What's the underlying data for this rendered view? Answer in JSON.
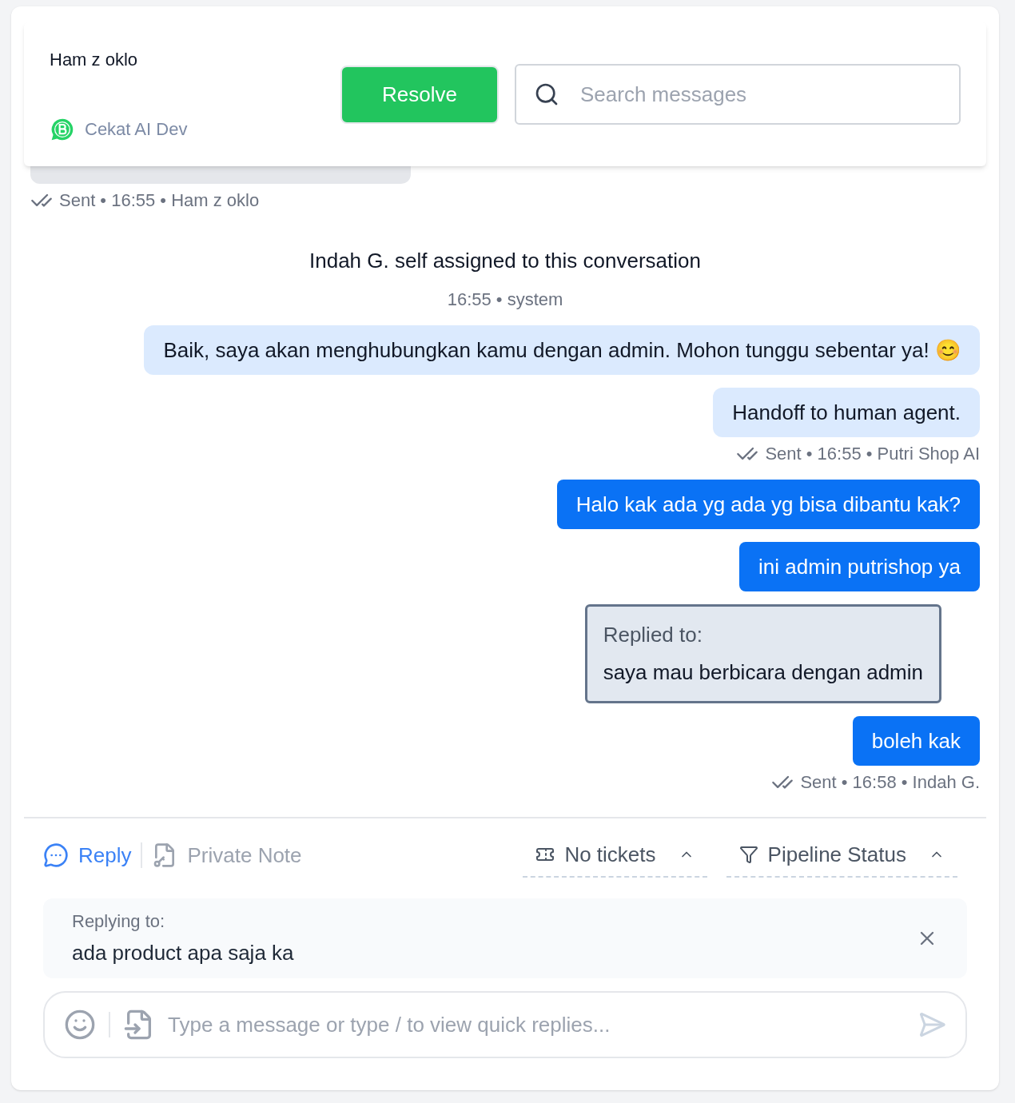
{
  "header": {
    "contact_name": "Ham z oklo",
    "inbox": "Cekat AI Dev",
    "resolve_button": "Resolve",
    "search": {
      "placeholder": "Search messages"
    }
  },
  "messages": [
    {
      "kind": "incoming-stub",
      "meta": "Sent • 16:55 • Ham z oklo"
    },
    {
      "kind": "system",
      "text": "Indah G. self assigned to this conversation",
      "meta": "16:55 • system"
    },
    {
      "kind": "bot",
      "text": "Baik, saya akan menghubungkan kamu dengan admin. Mohon tunggu sebentar ya! 😊"
    },
    {
      "kind": "bot",
      "text": "Handoff to human agent.",
      "meta": "Sent • 16:55 • Putri Shop AI"
    },
    {
      "kind": "agent",
      "text": "Halo kak ada yg ada yg bisa dibantu kak?"
    },
    {
      "kind": "agent",
      "text": "ini admin putrishop ya"
    },
    {
      "kind": "quote",
      "label": "Replied to:",
      "text": "saya mau berbicara dengan admin"
    },
    {
      "kind": "agent",
      "text": "boleh kak",
      "meta": "Sent • 16:58 • Indah G."
    }
  ],
  "composer": {
    "tabs": [
      {
        "label": "Reply",
        "selected": true
      },
      {
        "label": "Private Note",
        "selected": false
      }
    ],
    "dropdowns": [
      {
        "kind": "tickets",
        "label": "No tickets"
      },
      {
        "kind": "pipeline",
        "label": "Pipeline Status"
      }
    ],
    "replying": {
      "label": "Replying to:",
      "text": "ada product apa saja ka"
    },
    "input": {
      "placeholder": "Type a message or type / to view quick replies..."
    }
  }
}
